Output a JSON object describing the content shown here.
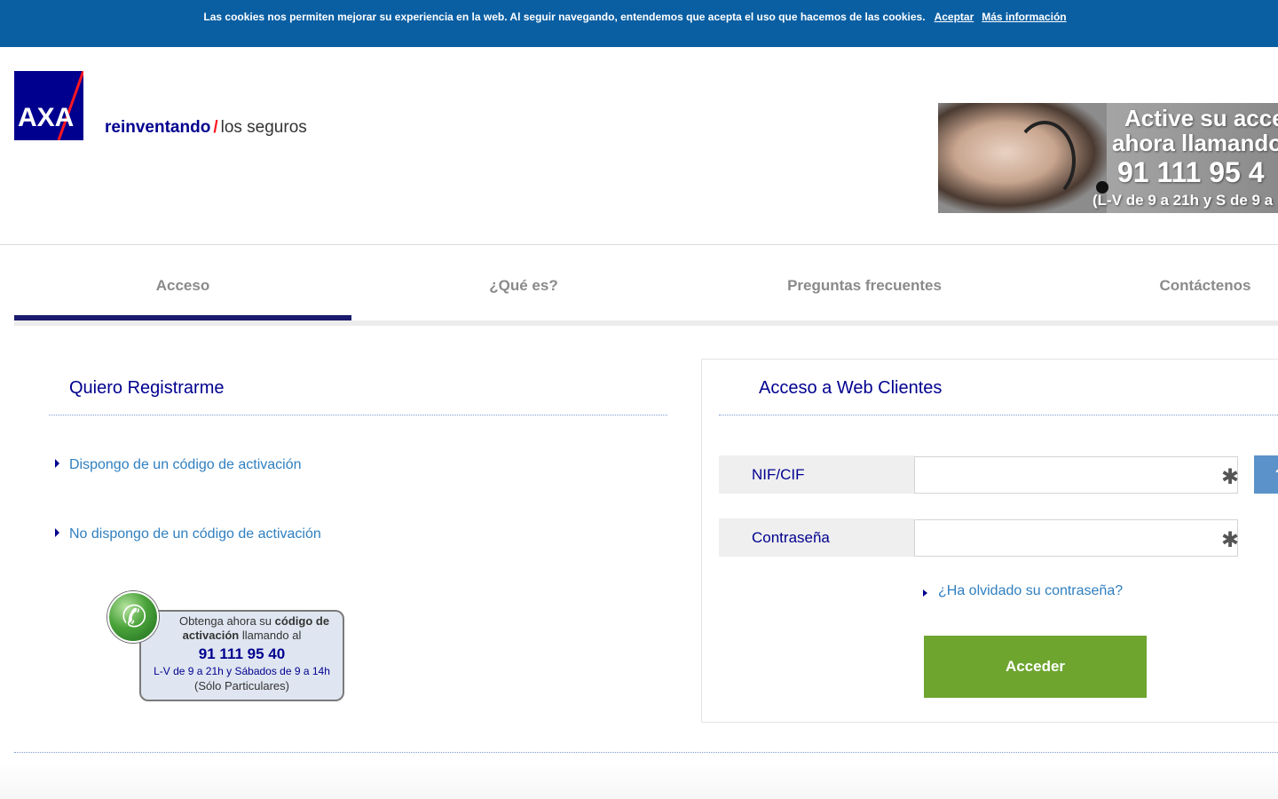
{
  "cookie_bar": {
    "text": "Las cookies nos permiten mejorar su experiencia en la web. Al seguir navegando, entendemos que acepta el uso que hacemos de las cookies.",
    "accept_label": "Aceptar",
    "more_info_label": "Más información"
  },
  "header": {
    "logo_text": "AXA",
    "tagline_bold": "reinventando",
    "tagline_light": "los seguros",
    "banner": {
      "line1": "Active su acce",
      "line2": "ahora llamando",
      "phone": "91 111 95 4",
      "hours": "(L-V de 9 a 21h y S de 9 a"
    }
  },
  "tabs": [
    {
      "label": "Acceso",
      "active": true
    },
    {
      "label": "¿Qué es?",
      "active": false
    },
    {
      "label": "Preguntas frecuentes",
      "active": false
    },
    {
      "label": "Contáctenos",
      "active": false
    }
  ],
  "register": {
    "title": "Quiero Registrarme",
    "link_with_code": "Dispongo de un código de activación",
    "link_without_code": "No dispongo de un código de activación",
    "promo": {
      "line1_prefix": "Obtenga ahora su ",
      "line1_bold": "código de",
      "line2_bold": "activación",
      "line2_suffix": " llamando al",
      "phone": "91 111 95 40",
      "hours": "L-V de 9 a 21h y Sábados de 9 a 14h",
      "note": "(Sólo Particulares)"
    }
  },
  "login": {
    "title": "Acceso a Web Clientes",
    "nif_label": "NIF/CIF",
    "nif_value": "",
    "password_label": "Contraseña",
    "password_value": "",
    "required_mark": "✱",
    "help_label": "?",
    "forgot_label": "¿Ha olvidado su contraseña?",
    "submit_label": "Acceder"
  },
  "colors": {
    "cookie_bar": "#0a5fa3",
    "brand_blue": "#00008f",
    "brand_red": "#ff1721",
    "link_blue": "#2f7fc0",
    "submit_green": "#6ea52f"
  }
}
